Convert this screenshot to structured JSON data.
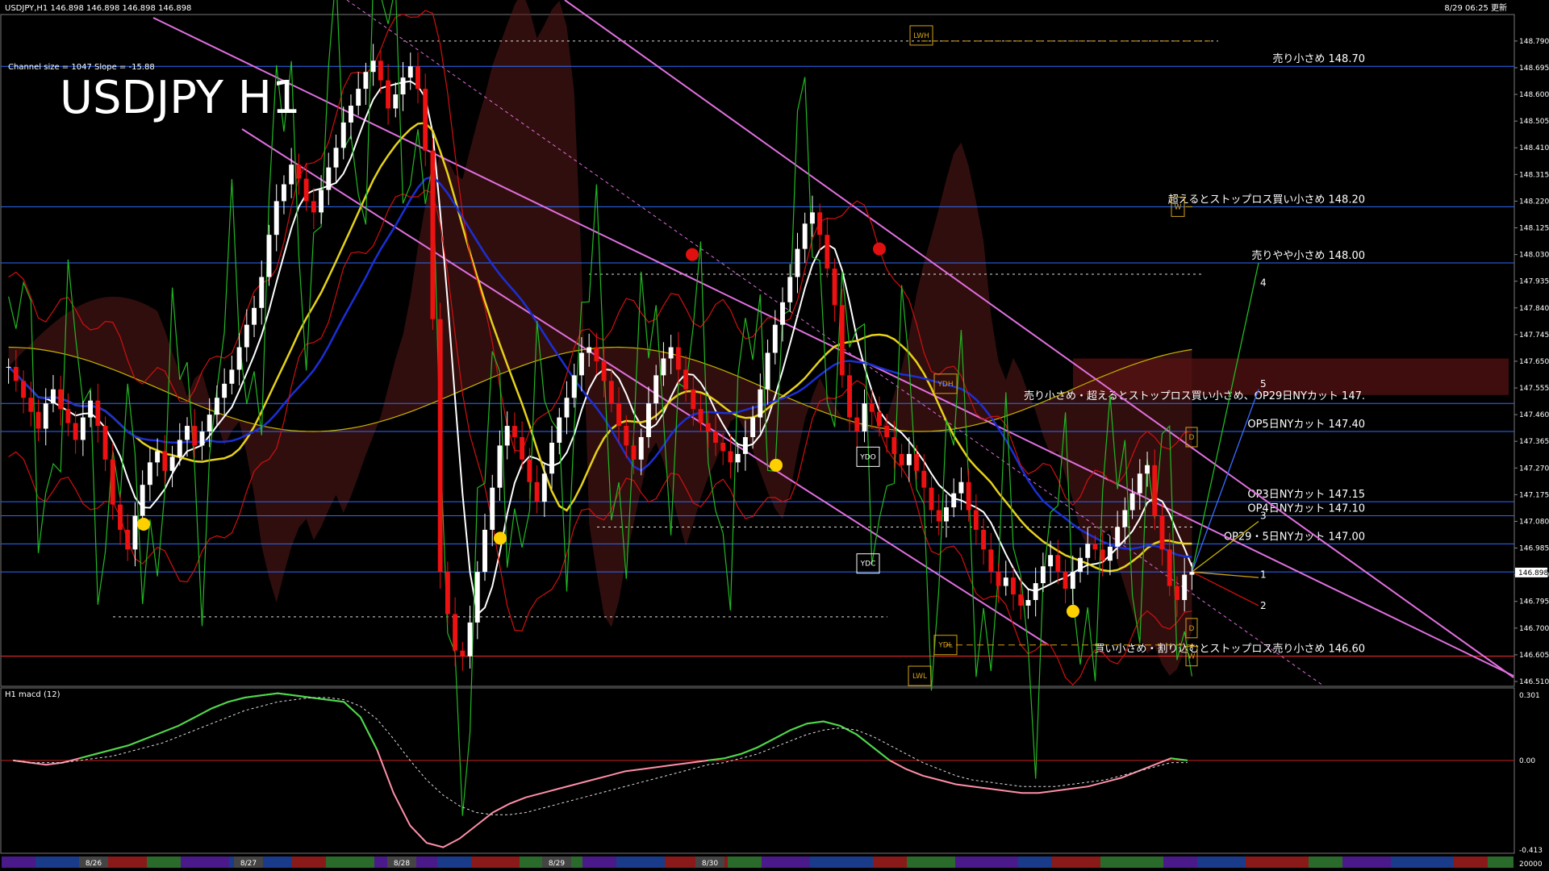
{
  "header": {
    "symbol_info": "USDJPY,H1  146.898 146.898 146.898 146.898",
    "timestamp": "8/29 06:25 更新",
    "channel_info": "Channel size = 1047 Slope = -15.88",
    "big_title": "USDJPY H1"
  },
  "chart_data": {
    "type": "candlestick",
    "symbol": "USDJPY",
    "timeframe": "H1",
    "ylim": [
      146.51,
      148.85
    ],
    "price_ticks": [
      148.79,
      148.695,
      148.6,
      148.505,
      148.41,
      148.315,
      148.22,
      148.125,
      148.03,
      147.935,
      147.84,
      147.745,
      147.65,
      147.555,
      147.46,
      147.365,
      147.27,
      147.175,
      147.08,
      146.985,
      146.89,
      146.795,
      146.7,
      146.605,
      146.51
    ],
    "current_price": "146.898",
    "closes": [
      147.63,
      147.58,
      147.52,
      147.47,
      147.41,
      147.5,
      147.55,
      147.48,
      147.43,
      147.37,
      147.45,
      147.51,
      147.42,
      147.3,
      147.14,
      147.05,
      146.98,
      147.1,
      147.21,
      147.29,
      147.33,
      147.26,
      147.31,
      147.37,
      147.42,
      147.35,
      147.4,
      147.46,
      147.52,
      147.57,
      147.62,
      147.7,
      147.78,
      147.84,
      147.95,
      148.1,
      148.22,
      148.28,
      148.35,
      148.3,
      148.22,
      148.18,
      148.26,
      148.34,
      148.41,
      148.5,
      148.56,
      148.62,
      148.68,
      148.72,
      148.65,
      148.55,
      148.6,
      148.66,
      148.7,
      148.62,
      148.4,
      147.8,
      146.9,
      146.75,
      146.62,
      146.6,
      146.72,
      146.9,
      147.05,
      147.2,
      147.35,
      147.42,
      147.38,
      147.3,
      147.22,
      147.15,
      147.25,
      147.36,
      147.45,
      147.52,
      147.6,
      147.68,
      147.7,
      147.65,
      147.58,
      147.5,
      147.42,
      147.35,
      147.3,
      147.38,
      147.5,
      147.6,
      147.66,
      147.7,
      147.62,
      147.55,
      147.48,
      147.43,
      147.4,
      147.36,
      147.33,
      147.29,
      147.32,
      147.38,
      147.45,
      147.55,
      147.68,
      147.78,
      147.86,
      147.95,
      148.05,
      148.14,
      148.18,
      148.1,
      147.98,
      147.85,
      147.6,
      147.45,
      147.4,
      147.5,
      147.47,
      147.42,
      147.38,
      147.32,
      147.28,
      147.32,
      147.26,
      147.2,
      147.12,
      147.08,
      147.13,
      147.18,
      147.22,
      147.12,
      147.05,
      146.98,
      146.9,
      146.85,
      146.88,
      146.82,
      146.78,
      146.8,
      146.86,
      146.92,
      146.96,
      146.9,
      146.84,
      146.9,
      146.95,
      147.0,
      146.98,
      146.94,
      146.99,
      147.06,
      147.12,
      147.18,
      147.25,
      147.28,
      147.1,
      146.98,
      146.85,
      146.8,
      146.89,
      146.9
    ],
    "horizontal_levels": [
      {
        "price": 148.7,
        "label": "売り小さめ 148.70",
        "color": "#2b6cff"
      },
      {
        "price": 148.2,
        "label": "超えるとストップロス買い小さめ 148.20",
        "color": "#2b6cff"
      },
      {
        "price": 148.0,
        "label": "売りやや小さめ 148.00",
        "color": "#2b6cff"
      },
      {
        "price": 147.5,
        "label": "売り小さめ・超えるとストップロス買い小さめ、OP29日NYカット 147.",
        "color": "#2b6cff"
      },
      {
        "price": 147.4,
        "label": "OP5日NYカット 147.40",
        "color": "#2b6cff"
      },
      {
        "price": 147.15,
        "label": "OP3日NYカット 147.15",
        "color": "#2b6cff"
      },
      {
        "price": 147.1,
        "label": "OP4日NYカット 147.10",
        "color": "#2b6cff"
      },
      {
        "price": 147.0,
        "label": "OP29・5日NYカット 147.00",
        "color": "#2b6cff"
      },
      {
        "price": 146.9,
        "label": "",
        "color": "#2b6cff"
      },
      {
        "price": 146.6,
        "label": "買い小さめ・割り込むとストップロス売り小さめ 146.60",
        "color": "#ff3030"
      }
    ],
    "box_markers": [
      {
        "label": "LWH",
        "color": "#d4a017"
      },
      {
        "label": "W",
        "color": "#d4a017"
      },
      {
        "label": "YDH",
        "color": "#d4a017"
      },
      {
        "label": "YDO",
        "color": "#ffffff"
      },
      {
        "label": "YDC",
        "color": "#ffffff"
      },
      {
        "label": "D",
        "color": "#d4a017"
      },
      {
        "label": "D",
        "color": "#d4a017"
      },
      {
        "label": "W",
        "color": "#d4a017"
      },
      {
        "label": "YDL",
        "color": "#d4a017"
      },
      {
        "label": "LWL",
        "color": "#d4a017"
      }
    ],
    "projection_labels": [
      "4",
      "5",
      "3",
      "1",
      "2"
    ],
    "date_labels": [
      "8/26",
      "8/27",
      "8/28",
      "8/29",
      "8/30"
    ]
  },
  "macd": {
    "label": "H1  macd (12)",
    "ticks": [
      "0.301",
      "0.00",
      "-0.413"
    ],
    "ylim": [
      -0.413,
      0.301
    ],
    "main": [
      0.0,
      -0.01,
      -0.02,
      -0.01,
      0.01,
      0.03,
      0.05,
      0.07,
      0.1,
      0.13,
      0.16,
      0.2,
      0.24,
      0.27,
      0.29,
      0.3,
      0.31,
      0.3,
      0.29,
      0.28,
      0.27,
      0.2,
      0.05,
      -0.15,
      -0.3,
      -0.38,
      -0.4,
      -0.36,
      -0.3,
      -0.24,
      -0.2,
      -0.17,
      -0.15,
      -0.13,
      -0.11,
      -0.09,
      -0.07,
      -0.05,
      -0.04,
      -0.03,
      -0.02,
      -0.01,
      0.0,
      0.01,
      0.03,
      0.06,
      0.1,
      0.14,
      0.17,
      0.18,
      0.16,
      0.12,
      0.06,
      0.0,
      -0.04,
      -0.07,
      -0.09,
      -0.11,
      -0.12,
      -0.13,
      -0.14,
      -0.15,
      -0.15,
      -0.14,
      -0.13,
      -0.12,
      -0.1,
      -0.08,
      -0.05,
      -0.02,
      0.01,
      0.0
    ],
    "signal": [
      0.0,
      -0.01,
      -0.01,
      -0.01,
      0.0,
      0.01,
      0.02,
      0.04,
      0.06,
      0.08,
      0.11,
      0.14,
      0.17,
      0.2,
      0.23,
      0.25,
      0.27,
      0.28,
      0.29,
      0.29,
      0.28,
      0.25,
      0.19,
      0.1,
      0.0,
      -0.09,
      -0.16,
      -0.21,
      -0.24,
      -0.25,
      -0.25,
      -0.24,
      -0.22,
      -0.2,
      -0.18,
      -0.16,
      -0.14,
      -0.12,
      -0.1,
      -0.08,
      -0.06,
      -0.04,
      -0.02,
      -0.01,
      0.01,
      0.03,
      0.06,
      0.09,
      0.12,
      0.14,
      0.15,
      0.14,
      0.11,
      0.07,
      0.03,
      -0.01,
      -0.04,
      -0.07,
      -0.09,
      -0.1,
      -0.11,
      -0.12,
      -0.12,
      -0.12,
      -0.11,
      -0.1,
      -0.09,
      -0.07,
      -0.05,
      -0.03,
      -0.01,
      -0.01
    ],
    "right_label": "20000"
  }
}
